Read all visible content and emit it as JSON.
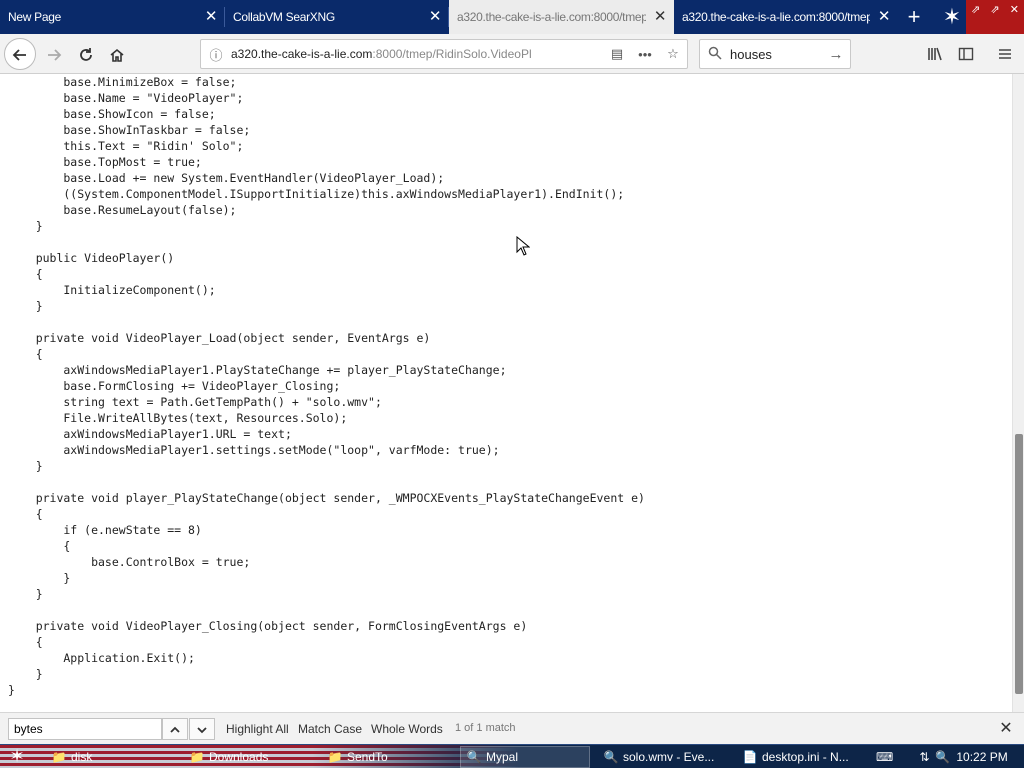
{
  "tabs": [
    {
      "label": "New Page",
      "selected": false
    },
    {
      "label": "CollabVM SearXNG",
      "selected": false
    },
    {
      "label": "a320.the-cake-is-a-lie.com:8000/tmep",
      "selected": true
    },
    {
      "label": "a320.the-cake-is-a-lie.com:8000/tmep",
      "selected": false
    }
  ],
  "window_controls": [
    "⇗",
    "⇗",
    "✕"
  ],
  "navbar": {
    "url_host": "a320.the-cake-is-a-lie.com",
    "url_path": ":8000/tmep/RidinSolo.VideoPl",
    "search_value": "houses"
  },
  "code_lines": [
    "        base.MinimizeBox = false;",
    "        base.Name = \"VideoPlayer\";",
    "        base.ShowIcon = false;",
    "        base.ShowInTaskbar = false;",
    "        this.Text = \"Ridin' Solo\";",
    "        base.TopMost = true;",
    "        base.Load += new System.EventHandler(VideoPlayer_Load);",
    "        ((System.ComponentModel.ISupportInitialize)this.axWindowsMediaPlayer1).EndInit();",
    "        base.ResumeLayout(false);",
    "    }",
    "",
    "    public VideoPlayer()",
    "    {",
    "        InitializeComponent();",
    "    }",
    "",
    "    private void VideoPlayer_Load(object sender, EventArgs e)",
    "    {",
    "        axWindowsMediaPlayer1.PlayStateChange += player_PlayStateChange;",
    "        base.FormClosing += VideoPlayer_Closing;",
    "        string text = Path.GetTempPath() + \"solo.wmv\";",
    "        File.WriteAllBytes(text, Resources.Solo);",
    "        axWindowsMediaPlayer1.URL = text;",
    "        axWindowsMediaPlayer1.settings.setMode(\"loop\", varfMode: true);",
    "    }",
    "",
    "    private void player_PlayStateChange(object sender, _WMPOCXEvents_PlayStateChangeEvent e)",
    "    {",
    "        if (e.newState == 8)",
    "        {",
    "            base.ControlBox = true;",
    "        }",
    "    }",
    "",
    "    private void VideoPlayer_Closing(object sender, FormClosingEventArgs e)",
    "    {",
    "        Application.Exit();",
    "    }",
    "}"
  ],
  "findbar": {
    "query": "bytes",
    "highlight_all": "Highlight All",
    "match_case": "Match Case",
    "whole_words": "Whole Words",
    "status": "1 of 1 match"
  },
  "taskbar": {
    "items": [
      {
        "label": "disk",
        "icon": "📁"
      },
      {
        "label": "Downloads",
        "icon": "📁"
      },
      {
        "label": "SendTo",
        "icon": "📁"
      },
      {
        "label": "Mypal",
        "icon": "🔍"
      },
      {
        "label": "solo.wmv - Eve...",
        "icon": "🔍"
      },
      {
        "label": "desktop.ini - N...",
        "icon": "📄"
      }
    ],
    "clock": "10:22 PM"
  },
  "colors": {
    "tabstrip_bg": "#0a2a6a",
    "window_controls_bg": "#b01818",
    "taskbar_bg": "#0d2548"
  }
}
